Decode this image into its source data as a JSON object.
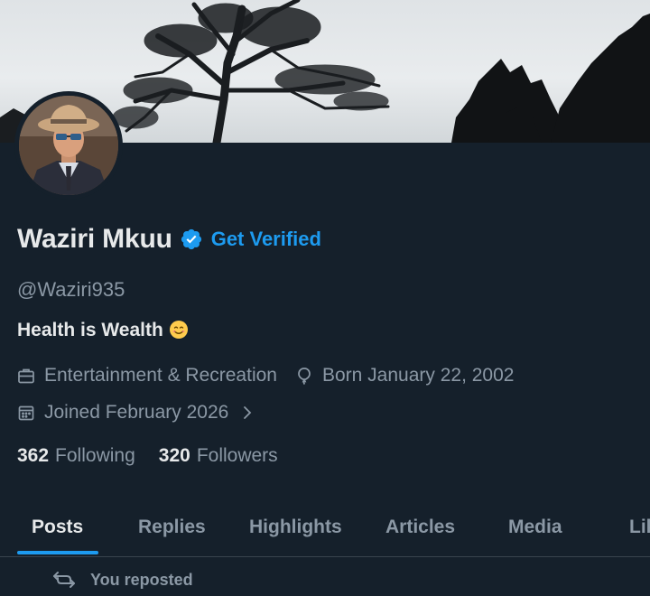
{
  "profile": {
    "name": "Waziri Mkuu",
    "get_verified_label": "Get Verified",
    "handle": "@Waziri935",
    "bio": "Health is Wealth",
    "bio_emoji": "smiling-face-emoji",
    "category": "Entertainment & Recreation",
    "birthday": "Born January 22, 2002",
    "joined": "Joined February 2026"
  },
  "stats": {
    "following_count": "362",
    "following_label": "Following",
    "followers_count": "320",
    "followers_label": "Followers"
  },
  "tabs": [
    {
      "label": "Posts",
      "active": true
    },
    {
      "label": "Replies",
      "active": false
    },
    {
      "label": "Highlights",
      "active": false
    },
    {
      "label": "Articles",
      "active": false
    },
    {
      "label": "Media",
      "active": false
    },
    {
      "label": "Likes",
      "active": false
    }
  ],
  "feed": {
    "repost_label": "You reposted"
  },
  "icons": {
    "verified": "verified-badge-icon",
    "category": "briefcase-icon",
    "birthday": "balloon-icon",
    "joined": "calendar-icon",
    "chevron": "chevron-right-icon",
    "repost": "repost-icon"
  },
  "colors": {
    "background": "#15202b",
    "accent": "#1d9bf0",
    "primary_text": "#e7e9ea",
    "secondary_text": "#8b98a5",
    "divider": "#38444d"
  }
}
